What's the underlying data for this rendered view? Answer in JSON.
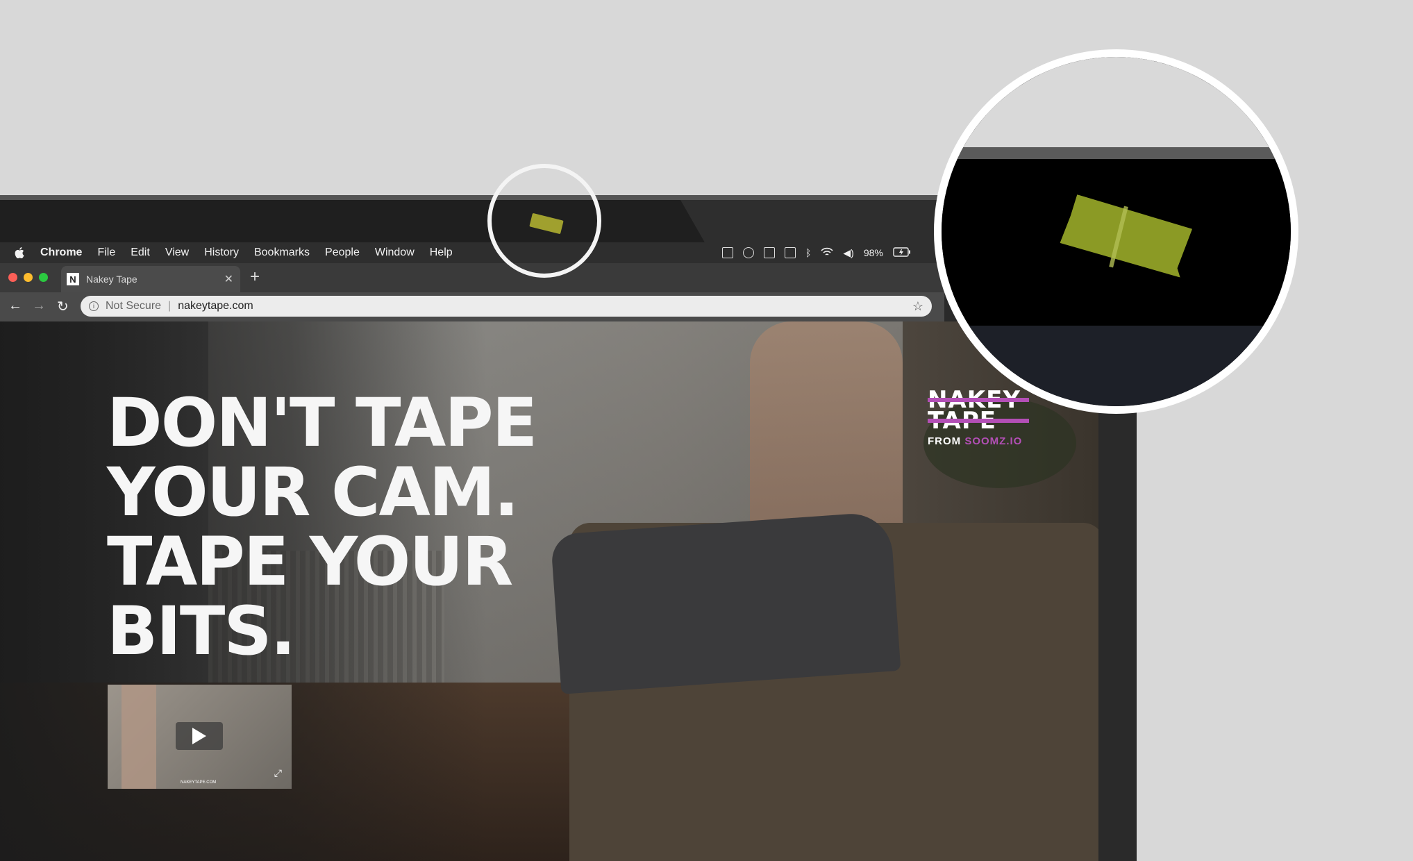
{
  "menubar": {
    "app": "Chrome",
    "items": [
      "File",
      "Edit",
      "View",
      "History",
      "Bookmarks",
      "People",
      "Window",
      "Help"
    ],
    "battery": "98%"
  },
  "tab": {
    "title": "Nakey Tape",
    "favicon_letter": "N"
  },
  "addressbar": {
    "security": "Not Secure",
    "url": "nakeytape.com"
  },
  "hero": {
    "lines": [
      "DON'T TAPE",
      "YOUR CAM.",
      "TAPE YOUR",
      "BITS."
    ]
  },
  "video": {
    "caption": "NAKEYTAPE.COM"
  },
  "logo": {
    "line1": "NAKEY",
    "line2": "TAPE",
    "from_word": "FROM",
    "from_brand": "SOOMZ.IO"
  },
  "colors": {
    "accent": "#b34fb6",
    "tape": "#8b9a25"
  },
  "icons": [
    "apple-icon",
    "wifi-icon",
    "volume-icon",
    "bluetooth-icon",
    "battery-icon",
    "info-icon",
    "star-icon",
    "play-icon",
    "expand-icon"
  ]
}
